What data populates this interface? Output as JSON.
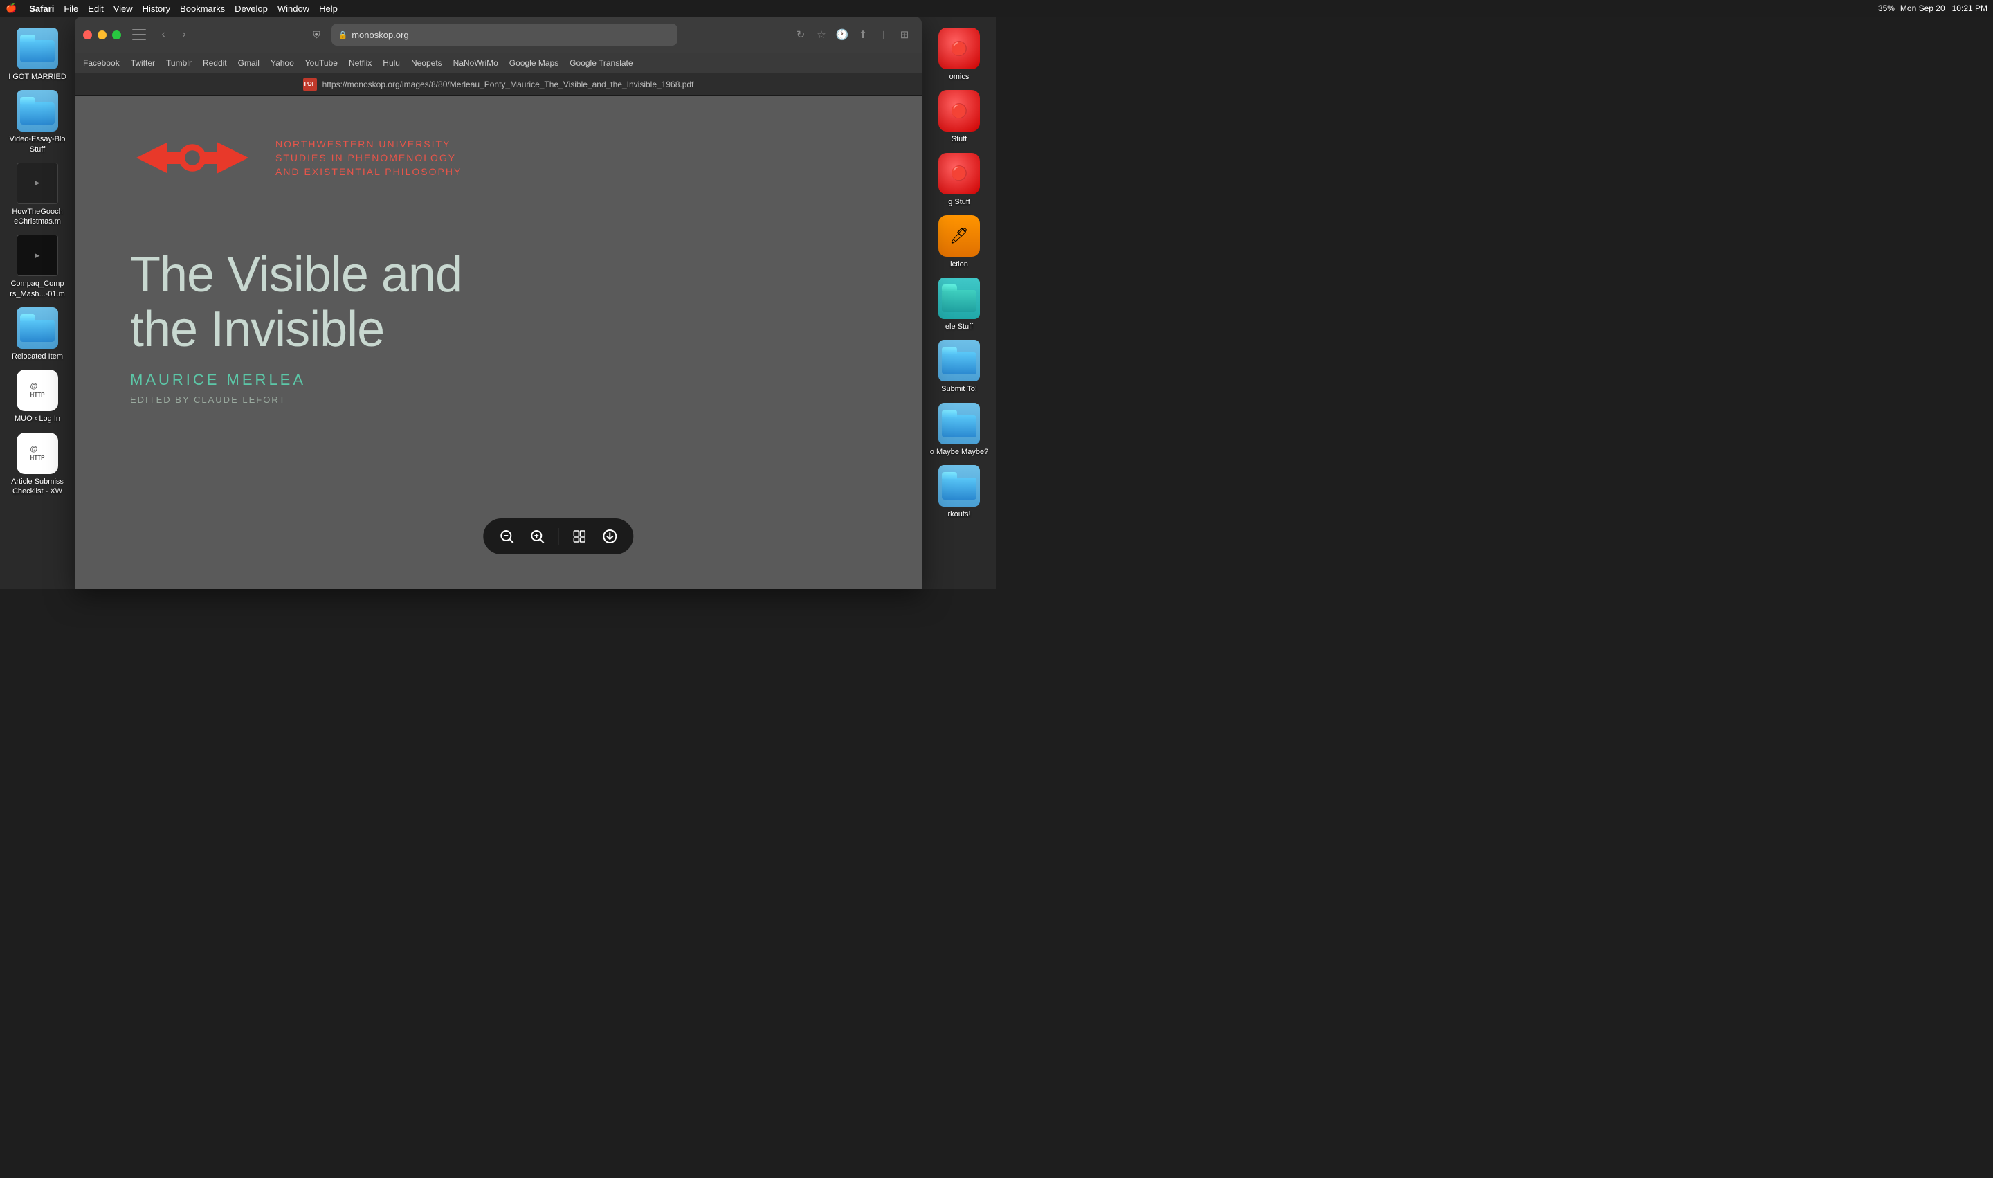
{
  "menubar": {
    "apple": "🍎",
    "items": [
      "Safari",
      "File",
      "Edit",
      "View",
      "History",
      "Bookmarks",
      "Develop",
      "Window",
      "Help"
    ],
    "right_items": [
      "Mon Sep 20",
      "10:21 PM"
    ],
    "battery": "35%"
  },
  "browser": {
    "url": "https://monoskop.org/images/8/80/Merleau_Ponty_Maurice_The_Visible_and_the_Invisible_1968.pdf",
    "display_url": "monoskop.org",
    "full_url": "https://monoskop.org/images/8/80/Merleau_Ponty_Maurice_The_Visible_and_the_Invisible_1968.pdf"
  },
  "bookmarks": {
    "items": [
      "Facebook",
      "Twitter",
      "Tumblr",
      "Reddit",
      "Gmail",
      "Yahoo",
      "YouTube",
      "Netflix",
      "Hulu",
      "Neopets",
      "NaNoWriMo",
      "Google Maps",
      "Google Translate"
    ]
  },
  "pdf": {
    "publisher_line1": "NORTHWESTERN UNIVERSITY",
    "publisher_line2": "STUDIES IN PHENOMENOLOGY",
    "publisher_line3": "AND EXISTENTIAL PHILOSOPHY",
    "title_line1": "The Visible and",
    "title_line2": "the Invisible",
    "author": "MAURICE MERLEA",
    "editor": "EDITED BY CLAUDE LEFORT"
  },
  "desktop_icons_left": [
    {
      "label": "I GOT MARRIED",
      "type": "folder-blue"
    },
    {
      "label": "Video-Essay-Blo Stuff",
      "type": "folder-blue"
    },
    {
      "label": "HowTheGooch eChristmas.m",
      "type": "dark-img"
    },
    {
      "label": "Compaq_Comp rs_Mash...-01.m",
      "type": "dark-img"
    },
    {
      "label": "Relocated Item",
      "type": "folder-blue"
    },
    {
      "label": "MUO ‹ Log In",
      "type": "http-icon"
    },
    {
      "label": "Article Submiss Checklist - XW",
      "type": "http-icon"
    }
  ],
  "desktop_icons_right": [
    {
      "label": "omics",
      "type": "red-circle"
    },
    {
      "label": "Stuff",
      "type": "red-circle"
    },
    {
      "label": "g Stuff",
      "type": "red-circle"
    },
    {
      "label": "iction",
      "type": "orange"
    },
    {
      "label": "ele Stuff",
      "type": "folder-teal"
    },
    {
      "label": "Submit To!",
      "type": "folder-blue"
    },
    {
      "label": "o Maybe Maybe?",
      "type": "folder-blue"
    },
    {
      "label": "rkouts!",
      "type": "folder-blue"
    }
  ],
  "pdf_toolbar": {
    "buttons": [
      "zoom-out",
      "zoom-in",
      "page-view",
      "download"
    ]
  }
}
